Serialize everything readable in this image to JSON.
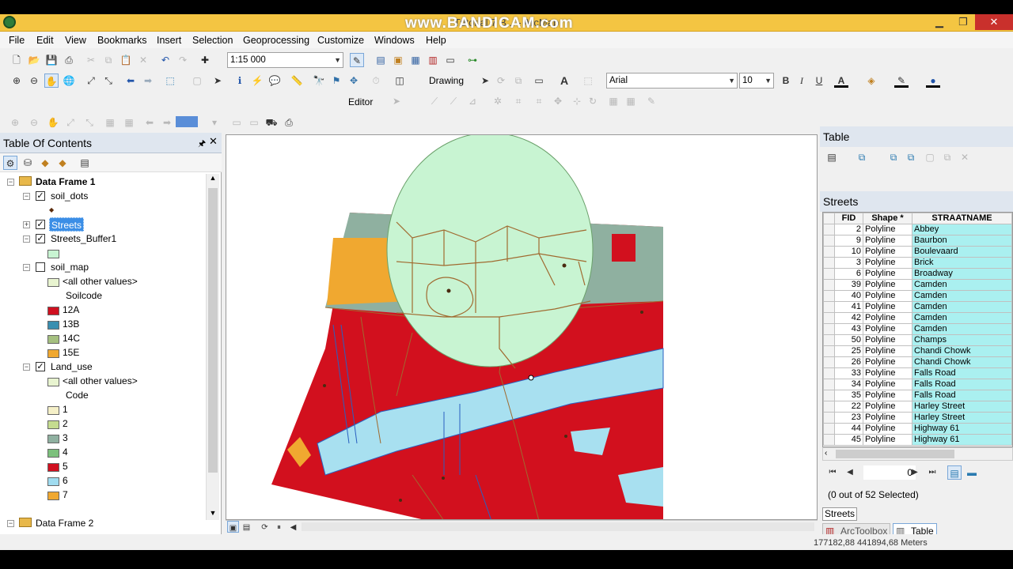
{
  "window": {
    "title": "Tutorial 7 B... - ArcMap",
    "watermark": "www.BANDICAM.com"
  },
  "menu": [
    "File",
    "Edit",
    "View",
    "Bookmarks",
    "Insert",
    "Selection",
    "Geoprocessing",
    "Customize",
    "Windows",
    "Help"
  ],
  "toolbar": {
    "scale": "1:15 000",
    "drawing_label": "Drawing",
    "font_name": "Arial",
    "font_size": "10",
    "editor_label": "Editor"
  },
  "toc": {
    "title": "Table Of Contents",
    "data_frame_1": "Data Frame 1",
    "data_frame_2": "Data Frame 2",
    "soil_dots": "soil_dots",
    "streets": "Streets",
    "streets_buffer": "Streets_Buffer1",
    "soil_map": "soil_map",
    "soil_other": "<all other values>",
    "soil_field": "Soilcode",
    "soil_classes": [
      {
        "label": "12A",
        "color": "#cf1020"
      },
      {
        "label": "13B",
        "color": "#3a8fb0"
      },
      {
        "label": "14C",
        "color": "#a5c080"
      },
      {
        "label": "15E",
        "color": "#f0a830"
      }
    ],
    "land_use": "Land_use",
    "land_other": "<all other values>",
    "land_field": "Code",
    "land_classes": [
      {
        "label": "1",
        "color": "#f5f0c8"
      },
      {
        "label": "2",
        "color": "#c5dc90"
      },
      {
        "label": "3",
        "color": "#8fb0a0"
      },
      {
        "label": "4",
        "color": "#7cc07c"
      },
      {
        "label": "5",
        "color": "#d01020"
      },
      {
        "label": "6",
        "color": "#a0dcf0"
      },
      {
        "label": "7",
        "color": "#f0a830"
      }
    ]
  },
  "table_panel": {
    "title": "Table",
    "layer_tab": "Streets",
    "columns": [
      "FID",
      "Shape *",
      "STRAATNAME"
    ],
    "rows": [
      {
        "fid": "2",
        "shape": "Polyline",
        "name": "Abbey"
      },
      {
        "fid": "9",
        "shape": "Polyline",
        "name": "Baurbon"
      },
      {
        "fid": "10",
        "shape": "Polyline",
        "name": "Boulevaard"
      },
      {
        "fid": "3",
        "shape": "Polyline",
        "name": "Brick"
      },
      {
        "fid": "6",
        "shape": "Polyline",
        "name": "Broadway"
      },
      {
        "fid": "39",
        "shape": "Polyline",
        "name": "Camden"
      },
      {
        "fid": "40",
        "shape": "Polyline",
        "name": "Camden"
      },
      {
        "fid": "41",
        "shape": "Polyline",
        "name": "Camden"
      },
      {
        "fid": "42",
        "shape": "Polyline",
        "name": "Camden"
      },
      {
        "fid": "43",
        "shape": "Polyline",
        "name": "Camden"
      },
      {
        "fid": "50",
        "shape": "Polyline",
        "name": "Champs"
      },
      {
        "fid": "25",
        "shape": "Polyline",
        "name": "Chandi Chowk"
      },
      {
        "fid": "26",
        "shape": "Polyline",
        "name": "Chandi Chowk"
      },
      {
        "fid": "33",
        "shape": "Polyline",
        "name": "Falls Road"
      },
      {
        "fid": "34",
        "shape": "Polyline",
        "name": "Falls Road"
      },
      {
        "fid": "35",
        "shape": "Polyline",
        "name": "Falls Road"
      },
      {
        "fid": "22",
        "shape": "Polyline",
        "name": "Harley Street"
      },
      {
        "fid": "23",
        "shape": "Polyline",
        "name": "Harley Street"
      },
      {
        "fid": "44",
        "shape": "Polyline",
        "name": "Highway 61"
      },
      {
        "fid": "45",
        "shape": "Polyline",
        "name": "Highway 61"
      }
    ],
    "record_value": "0",
    "selection_status": "(0 out of 52 Selected)",
    "bottom_tab": "Streets",
    "dock_tabs": [
      "ArcToolbox",
      "Table"
    ]
  },
  "status": {
    "coords": "177182,88  441894,68 Meters"
  }
}
